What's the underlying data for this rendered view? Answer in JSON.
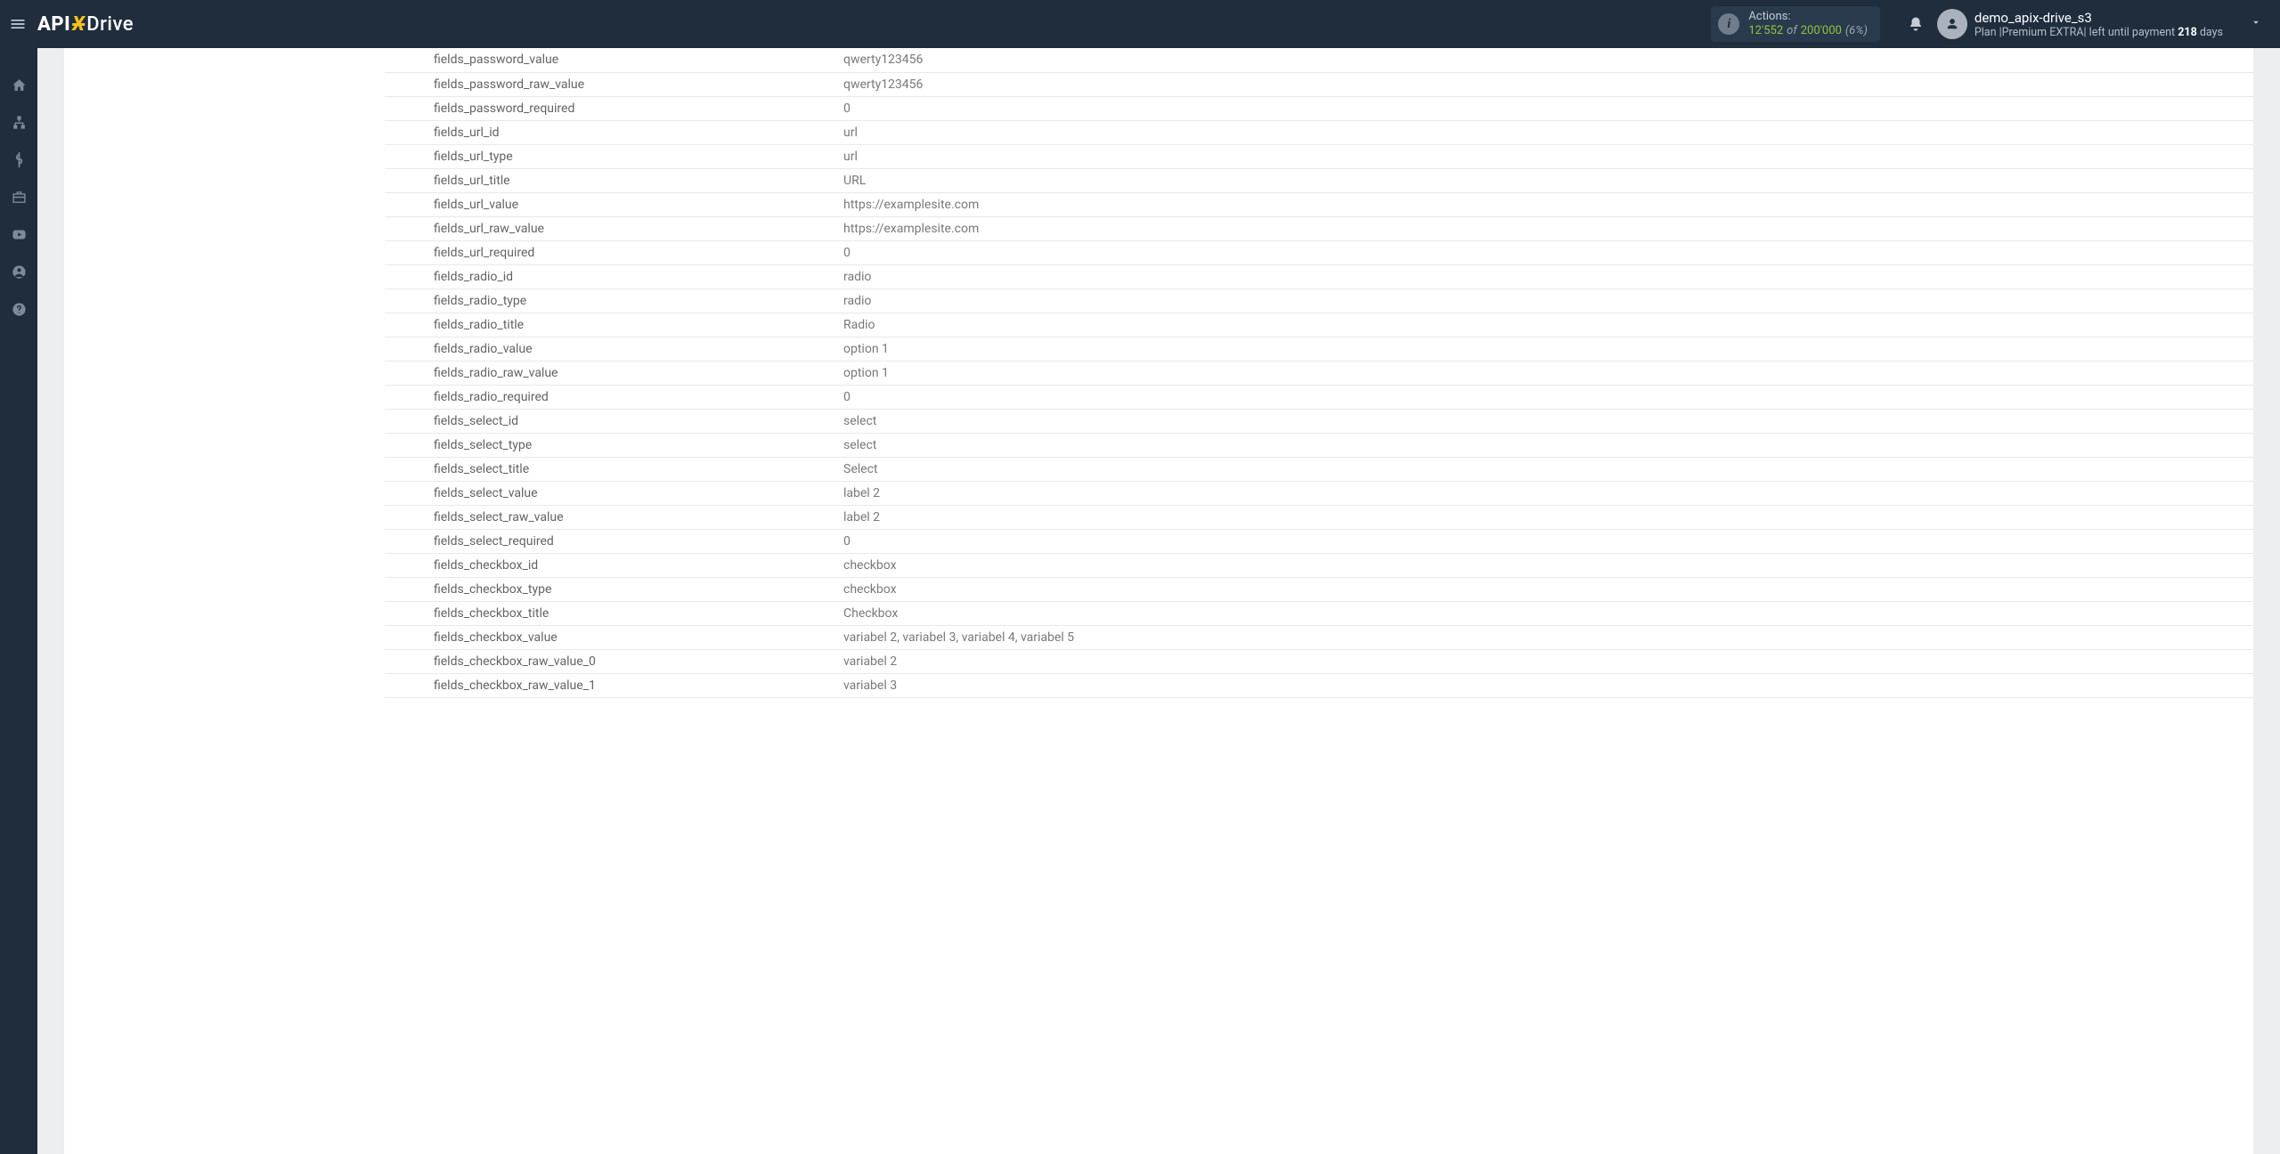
{
  "navbar": {
    "actions_label": "Actions:",
    "actions_used": "12'552",
    "actions_of": "of",
    "actions_total": "200'000",
    "actions_pct": "(6%)",
    "username": "demo_apix-drive_s3",
    "plan_prefix": "Plan |",
    "plan_name": "Premium EXTRA",
    "plan_mid": "| left until payment ",
    "plan_days": "218",
    "plan_suffix": " days"
  },
  "rows": [
    {
      "k": "fields_password_value",
      "v": "qwerty123456"
    },
    {
      "k": "fields_password_raw_value",
      "v": "qwerty123456"
    },
    {
      "k": "fields_password_required",
      "v": "0"
    },
    {
      "k": "fields_url_id",
      "v": "url"
    },
    {
      "k": "fields_url_type",
      "v": "url"
    },
    {
      "k": "fields_url_title",
      "v": "URL"
    },
    {
      "k": "fields_url_value",
      "v": "https://examplesite.com"
    },
    {
      "k": "fields_url_raw_value",
      "v": "https://examplesite.com"
    },
    {
      "k": "fields_url_required",
      "v": "0"
    },
    {
      "k": "fields_radio_id",
      "v": "radio"
    },
    {
      "k": "fields_radio_type",
      "v": "radio"
    },
    {
      "k": "fields_radio_title",
      "v": "Radio"
    },
    {
      "k": "fields_radio_value",
      "v": "option 1"
    },
    {
      "k": "fields_radio_raw_value",
      "v": "option 1"
    },
    {
      "k": "fields_radio_required",
      "v": "0"
    },
    {
      "k": "fields_select_id",
      "v": "select"
    },
    {
      "k": "fields_select_type",
      "v": "select"
    },
    {
      "k": "fields_select_title",
      "v": "Select"
    },
    {
      "k": "fields_select_value",
      "v": "label 2"
    },
    {
      "k": "fields_select_raw_value",
      "v": "label 2"
    },
    {
      "k": "fields_select_required",
      "v": "0"
    },
    {
      "k": "fields_checkbox_id",
      "v": "checkbox"
    },
    {
      "k": "fields_checkbox_type",
      "v": "checkbox"
    },
    {
      "k": "fields_checkbox_title",
      "v": "Checkbox"
    },
    {
      "k": "fields_checkbox_value",
      "v": "variabel 2, variabel 3, variabel 4, variabel 5"
    },
    {
      "k": "fields_checkbox_raw_value_0",
      "v": "variabel 2"
    },
    {
      "k": "fields_checkbox_raw_value_1",
      "v": "variabel 3"
    }
  ]
}
